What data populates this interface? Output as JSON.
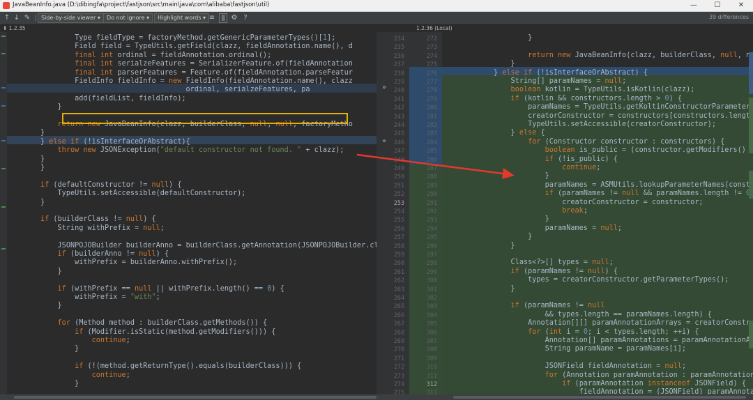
{
  "window": {
    "title": "JavaBeanInfo.java (D:\\dibingfa\\project\\fastjson\\src\\main\\java\\com\\alibaba\\fastjson\\util)",
    "minimize": "—",
    "maximize": "☐",
    "close": "✕"
  },
  "toolbar": {
    "viewer_mode": "Side-by-side viewer ▾",
    "ignore_mode": "Do not ignore ▾",
    "highlight_mode": "Highlight words ▾",
    "differences": "39 differences"
  },
  "left_version": "⬆ 1.2.35",
  "right_version": "1.2.36 (Local)",
  "left_code": [
    "        Type fieldType = factoryMethod.getGenericParameterTypes()[1];",
    "        Field field = TypeUtils.getField(clazz, fieldAnnotation.name(), d",
    "        final int ordinal = fieldAnnotation.ordinal();",
    "        final int serialzeFeatures = SerializerFeature.of(fieldAnnotation",
    "        final int parserFeatures = Feature.of(fieldAnnotation.parseFeatur",
    "        FieldInfo fieldInfo = new FieldInfo(fieldAnnotation.name(), clazz",
    "                                  ordinal, serialzeFeatures, pa",
    "        add(fieldList, fieldInfo);",
    "    }",
    "",
    "    return new JavaBeanInfo(clazz, builderClass, null, null, factoryMetho",
    "}",
    "} else if (!isInterfaceOrAbstract){",
    "    throw new JSONException(\"default constructor not found. \" + clazz);",
    "}",
    "}",
    "",
    "if (defaultConstructor != null) {",
    "    TypeUtils.setAccessible(defaultConstructor);",
    "}",
    "",
    "if (builderClass != null) {",
    "    String withPrefix = null;",
    "",
    "    JSONPOJOBuilder builderAnno = builderClass.getAnnotation(JSONPOJOBuilder.clas",
    "    if (builderAnno != null) {",
    "        withPrefix = builderAnno.withPrefix();",
    "    }",
    "",
    "    if (withPrefix == null || withPrefix.length() == 0) {",
    "        withPrefix = \"with\";",
    "    }",
    "",
    "    for (Method method : builderClass.getMethods()) {",
    "        if (Modifier.isStatic(method.getModifiers())) {",
    "            continue;",
    "        }",
    "",
    "        if (!(method.getReturnType().equals(builderClass))) {",
    "            continue;",
    "        }",
    ""
  ],
  "left_numbers": [
    "",
    "234",
    "235",
    "236",
    "237",
    "238",
    "239",
    "240",
    "241",
    "242",
    "243",
    "244",
    "245",
    "246",
    "247",
    "248",
    "249",
    "250",
    "251",
    "252",
    "253",
    "254",
    "255",
    "256",
    "257",
    "258",
    "259",
    "260",
    "261",
    "262",
    "263",
    "264",
    "265",
    "266",
    "267",
    "268",
    "269",
    "270",
    "271",
    "272",
    "273",
    "274",
    "275"
  ],
  "right_numbers": [
    "272",
    "273",
    "274",
    "275",
    "276",
    "277",
    "278",
    "279",
    "280",
    "281",
    "282",
    "283",
    "284",
    "285",
    "286",
    "287",
    "288",
    "289",
    "290",
    "291",
    "292",
    "293",
    "294",
    "295",
    "296",
    "297",
    "298",
    "299",
    "300",
    "301",
    "302",
    "303",
    "304",
    "305",
    "306",
    "307",
    "308",
    "309",
    "310",
    "311",
    "312",
    "313"
  ],
  "right_code": [
    "        }",
    "",
    "        return new JavaBeanInfo(clazz, builderClass, null, nu",
    "    }",
    "} else if (!isInterfaceOrAbstract) {",
    "    String[] paramNames = null;",
    "    boolean kotlin = TypeUtils.isKotlin(clazz);",
    "    if (kotlin && constructors.length > 0) {",
    "        paramNames = TypeUtils.getKoltinConstructorParameters(c",
    "        creatorConstructor = constructors[constructors.length",
    "        TypeUtils.setAccessible(creatorConstructor);",
    "    } else {",
    "        for (Constructor constructor : constructors) {",
    "            boolean is_public = (constructor.getModifiers() &",
    "            if (!is_public) {",
    "                continue;",
    "            }",
    "            paramNames = ASMUtils.lookupParameterNames(constru",
    "            if (paramNames != null && paramNames.length != 0)",
    "                creatorConstructor = constructor;",
    "                break;",
    "            }",
    "            paramNames = null;",
    "        }",
    "    }",
    "",
    "    Class<?>[] types = null;",
    "    if (paramNames != null) {",
    "        types = creatorConstructor.getParameterTypes();",
    "    }",
    "",
    "    if (paramNames != null",
    "            && types.length == paramNames.length) {",
    "        Annotation[][] paramAnnotationArrays = creatorConstruct",
    "        for (int i = 0; i < types.length; ++i) {",
    "            Annotation[] paramAnnotations = paramAnnotationArr",
    "            String paramName = paramNames[i];",
    "",
    "            JSONField fieldAnnotation = null;",
    "            for (Annotation paramAnnotation : paramAnnotations",
    "                if (paramAnnotation instanceof JSONField) {",
    "                    fieldAnnotation = (JSONField) paramAnnota"
  ],
  "mid_right_numbers": [
    "",
    "",
    "",
    "",
    "",
    "",
    "",
    "",
    "",
    "",
    "",
    "",
    "",
    "",
    "",
    "",
    "",
    "",
    "",
    "",
    "",
    "",
    "",
    "",
    "",
    "",
    "",
    "",
    "",
    "",
    "",
    "",
    "",
    "",
    "",
    "",
    "",
    "",
    "",
    "",
    "",
    ""
  ]
}
